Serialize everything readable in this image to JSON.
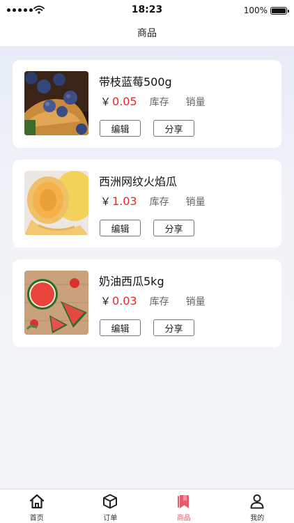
{
  "status_bar": {
    "time": "18:23",
    "battery_text": "100%",
    "battery_level": 1.0
  },
  "nav": {
    "title": "商品"
  },
  "products": [
    {
      "name": "带枝蓝莓500g",
      "currency": "￥",
      "price": "0.05",
      "stock_label": "库存",
      "sales_label": "销量",
      "edit_label": "编辑",
      "share_label": "分享",
      "image": "blueberries"
    },
    {
      "name": "西洲网纹火焰瓜",
      "currency": "￥",
      "price": "1.03",
      "stock_label": "库存",
      "sales_label": "销量",
      "edit_label": "编辑",
      "share_label": "分享",
      "image": "melon"
    },
    {
      "name": "奶油西瓜5kg",
      "currency": "￥",
      "price": "0.03",
      "stock_label": "库存",
      "sales_label": "销量",
      "edit_label": "编辑",
      "share_label": "分享",
      "image": "watermelon"
    }
  ],
  "tabs": [
    {
      "label": "首页",
      "icon": "home-icon",
      "active": false
    },
    {
      "label": "订单",
      "icon": "box-icon",
      "active": false
    },
    {
      "label": "商品",
      "icon": "bookmark-icon",
      "active": true
    },
    {
      "label": "我的",
      "icon": "person-icon",
      "active": false
    }
  ],
  "colors": {
    "accent": "#e35b6e",
    "price": "#e32a2a"
  }
}
